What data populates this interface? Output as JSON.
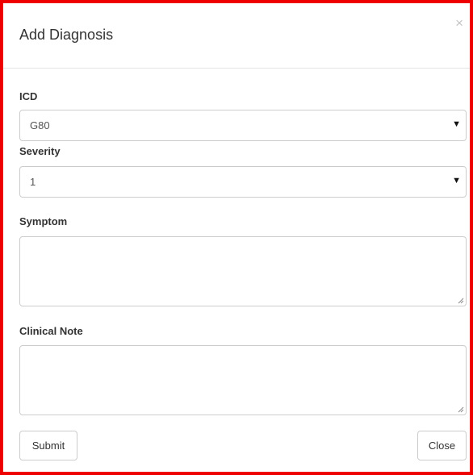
{
  "dialog": {
    "title": "Add Diagnosis",
    "close_glyph": "×"
  },
  "form": {
    "icd": {
      "label": "ICD",
      "selected_value": "G80",
      "caret_glyph": "▼"
    },
    "severity": {
      "label": "Severity",
      "selected_value": "1",
      "caret_glyph": "▼"
    },
    "symptom": {
      "label": "Symptom",
      "value": ""
    },
    "clinical_note": {
      "label": "Clinical Note",
      "value": ""
    }
  },
  "footer": {
    "submit_label": "Submit",
    "close_label": "Close"
  },
  "colors": {
    "frame_border": "#ee0000",
    "input_border": "#cccccc",
    "header_divider": "#e5e5e5"
  },
  "icons": {
    "close": "close-icon",
    "dropdown": "caret-down-icon",
    "resize": "resize-grip-icon"
  }
}
